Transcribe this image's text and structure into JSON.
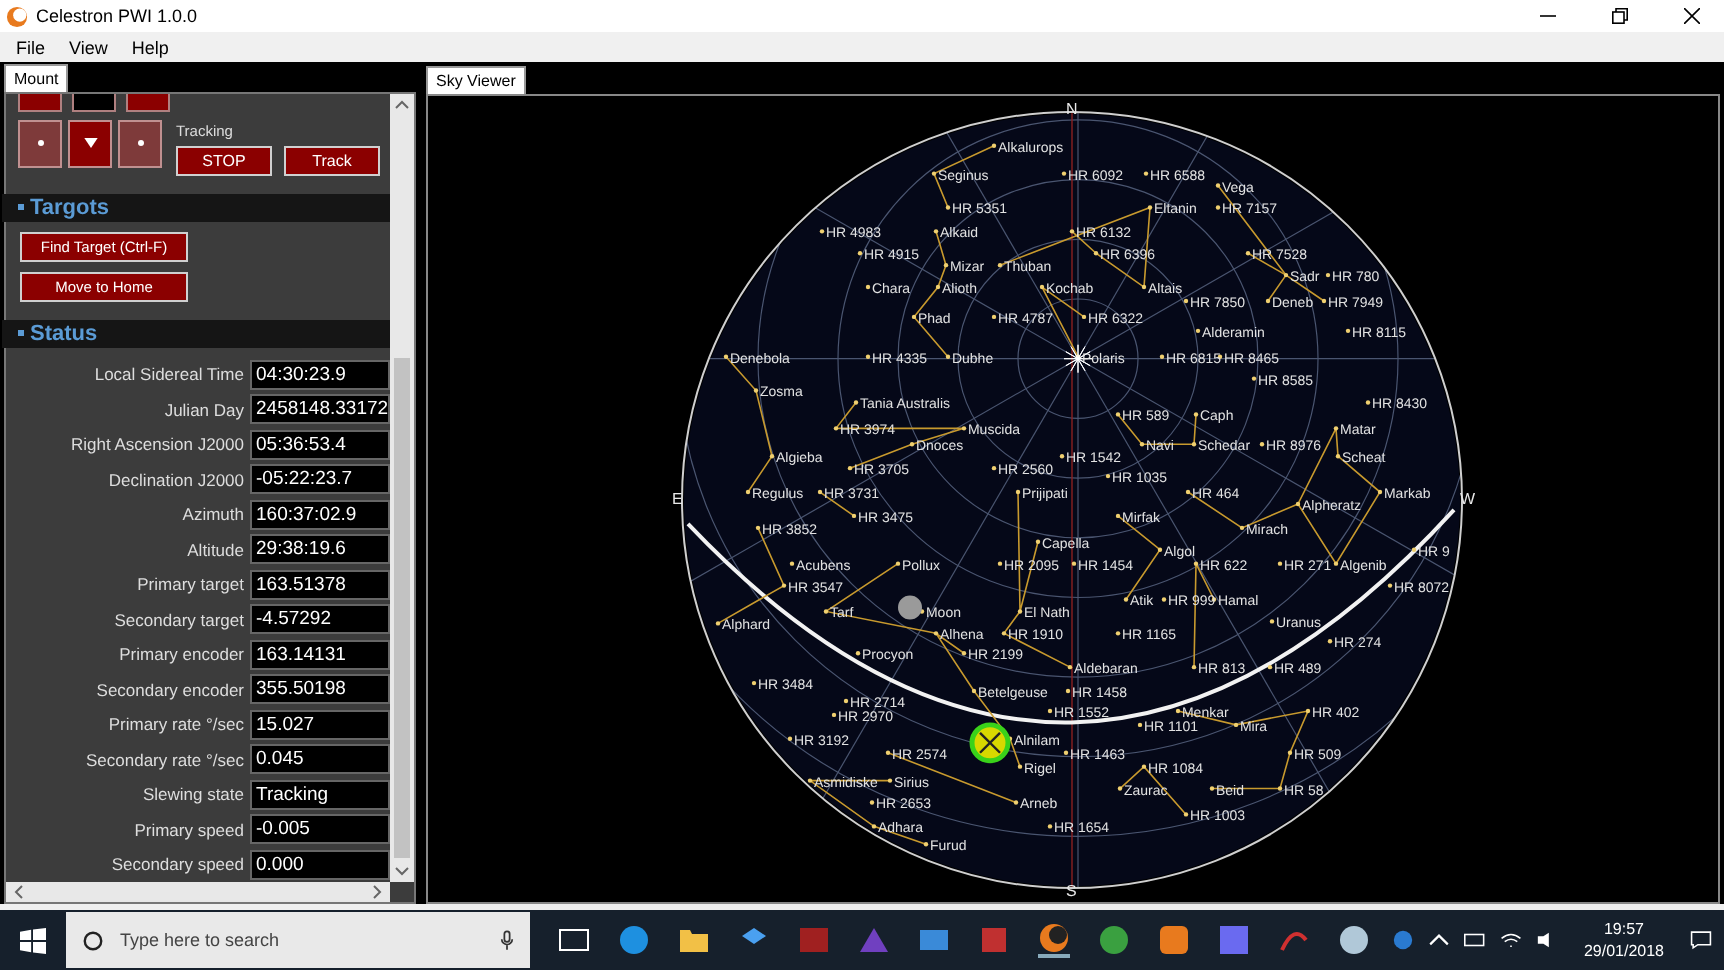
{
  "window": {
    "title": "Celestron PWI 1.0.0"
  },
  "menu": [
    "File",
    "View",
    "Help"
  ],
  "left_tab": {
    "label": "Mount",
    "selected": true
  },
  "mount": {
    "tracking_label": "Tracking",
    "buttons": [
      "STOP",
      "Track"
    ]
  },
  "targets": {
    "title": "Targots",
    "buttons": [
      "Find Target (Ctrl-F)",
      "Move to Home"
    ]
  },
  "status": {
    "title": "Status",
    "rows": [
      {
        "label": "Local Sidereal Time",
        "value": "04:30:23.9"
      },
      {
        "label": "Julian Day",
        "value": "2458148.33172"
      },
      {
        "label": "Right Ascension J2000",
        "value": "05:36:53.4"
      },
      {
        "label": "Declination J2000",
        "value": "-05:22:23.7"
      },
      {
        "label": "Azimuth",
        "value": "160:37:02.9"
      },
      {
        "label": "Altitude",
        "value": "29:38:19.6"
      },
      {
        "label": "Primary target",
        "value": "163.51378"
      },
      {
        "label": "Secondary target",
        "value": "-4.57292"
      },
      {
        "label": "Primary encoder",
        "value": "163.14131"
      },
      {
        "label": "Secondary encoder",
        "value": "355.50198"
      },
      {
        "label": "Primary rate °/sec",
        "value": "15.027"
      },
      {
        "label": "Secondary rate °/sec",
        "value": "0.045"
      },
      {
        "label": "Slewing state",
        "value": "Tracking"
      },
      {
        "label": "Primary speed",
        "value": "-0.005"
      },
      {
        "label": "Secondary speed",
        "value": "0.000"
      }
    ]
  },
  "sky_viewer": {
    "tab": {
      "label": "Sky Viewer",
      "selected": true
    },
    "compass": [
      "N",
      "E",
      "W",
      "S"
    ],
    "labels": [
      "Alkalurops",
      "Seginus",
      "HR 6092",
      "HR 6588",
      "Vega",
      "HR 5351",
      "Eltanin",
      "HR 7157",
      "HR 4983",
      "Alkaid",
      "HR 6132",
      "HR 4915",
      "HR 6396",
      "HR 7528",
      "Mizar",
      "Thuban",
      "Sadr",
      "HR 780",
      "Chara",
      "Alioth",
      "Kochab",
      "Altais",
      "HR 7850",
      "Deneb",
      "HR 7949",
      "Phad",
      "HR 4787",
      "HR 6322",
      "Alderamin",
      "HR 8115",
      "Denebola",
      "HR 4335",
      "Dubhe",
      "Polaris",
      "HR 6815",
      "HR 8465",
      "HR 8585",
      "Zosma",
      "Tania Australis",
      "HR 8430",
      "HR 589",
      "Caph",
      "HR 3974",
      "Muscida",
      "Matar",
      "Dnoces",
      "Navi",
      "Schedar",
      "HR 8976",
      "Algieba",
      "HR 1542",
      "Scheat",
      "HR 3705",
      "HR 2560",
      "HR 1035",
      "Regulus",
      "HR 3731",
      "Prijipati",
      "HR 464",
      "Markab",
      "Alpheratz",
      "HR 3475",
      "Mirfak",
      "HR 3852",
      "Mirach",
      "Capella",
      "Algol",
      "HR 9",
      "Acubens",
      "Pollux",
      "HR 2095",
      "HR 1454",
      "HR 622",
      "HR 271",
      "Algenib",
      "HR 3547",
      "HR 8072",
      "Atik",
      "HR 999",
      "Hamal",
      "Tarf",
      "Moon",
      "El Nath",
      "Alphard",
      "Alhena",
      "HR 1910",
      "HR 1165",
      "Uranus",
      "HR 274",
      "Procyon",
      "HR 2199",
      "Aldebaran",
      "HR 813",
      "HR 489",
      "HR 3484",
      "HR 2714",
      "Betelgeuse",
      "HR 1458",
      "HR 2970",
      "HR 1552",
      "Menkar",
      "HR 402",
      "HR 1101",
      "Mira",
      "HR 3192",
      "Alnilam",
      "HR 2574",
      "HR 1463",
      "HR 509",
      "Rigel",
      "HR 1084",
      "Asmidiske",
      "Sirius",
      "Zaurac",
      "Beid",
      "HR 58",
      "HR 2653",
      "Arneb",
      "HR 1003",
      "Adhara",
      "HR 1654",
      "Furud"
    ]
  },
  "taskbar": {
    "search_placeholder": "Type here to search",
    "time": "19:57",
    "date": "29/01/2018"
  }
}
